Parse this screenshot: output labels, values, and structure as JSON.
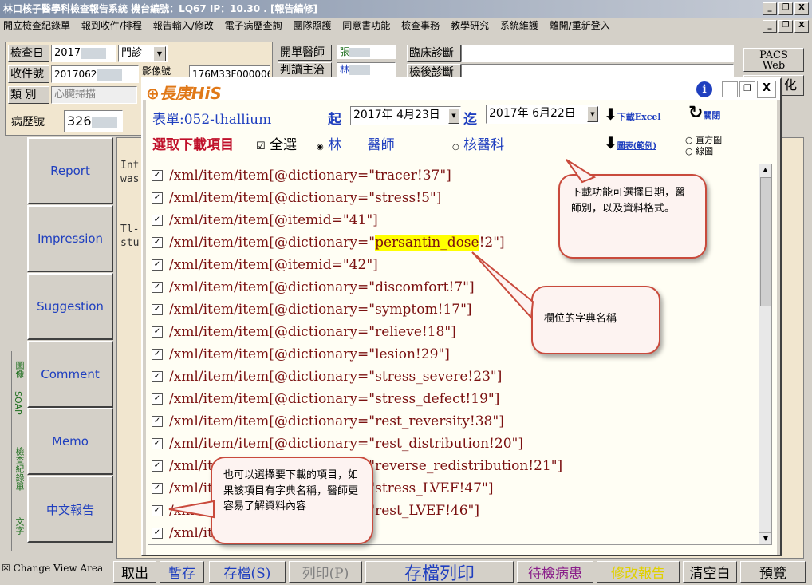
{
  "window": {
    "title": "林口核子醫學科檢查報告系統   機台編號：LQ67   IP：10.30       .     [報告編修]",
    "controls": [
      "_",
      "❐",
      "X"
    ]
  },
  "menu": [
    "開立檢查紀錄單",
    "報到收件/排程",
    "報告輸入/修改",
    "電子病歷查詢",
    "團隊照護",
    "同意書功能",
    "檢查事務",
    "教學研究",
    "系統維護",
    "離開/重新登入"
  ],
  "header": {
    "exam_date_label": "檢查日",
    "exam_date_value": "2017",
    "clinic_select": "門診",
    "receipt_label": "收件號",
    "receipt_value": "2017062",
    "image_no_label": "影像號",
    "image_no_value": "176M33F000006",
    "type_label": "類    別",
    "type_value": "心臟掃描",
    "chart_label": "病歷號",
    "chart_value": "326",
    "order_doctor_label": "開單醫師",
    "order_doctor_value": "張",
    "reading_doctor_label": "判讀主治",
    "reading_doctor_value": "林",
    "clinical_dx_label": "臨床診斷",
    "post_dx_label": "檢後診斷",
    "pacs_label": "PACS\nWeb",
    "style_button": "化"
  },
  "sidebar": {
    "buttons": [
      "Report",
      "Impression",
      "Suggestion",
      "Comment",
      "Memo",
      "中文報告"
    ],
    "vtabs": [
      "圖像",
      "SOAP",
      "檢查紀錄單",
      "文字"
    ]
  },
  "report_text": [
    "Int",
    "was",
    "Tl-",
    "stu"
  ],
  "bottom": {
    "change_view": "Change View Area",
    "buttons": [
      "取出",
      "暫存",
      "存檔(S)",
      "列印(P)",
      "存檔列印",
      "待檢病患",
      "修改報告",
      "清空白",
      "預覽"
    ]
  },
  "dialog": {
    "logo": "長庚HiS",
    "form_label": "表單:052-thallium",
    "from_label": "起",
    "from_date": "2017年  4月23日",
    "to_label": "迄",
    "to_date": "2017年  6月22日",
    "download_excel": "下載Excel",
    "close": "關閉",
    "select_label": "選取下載項目",
    "select_all": "全選",
    "doctor_option": "林      醫師",
    "dept_option": "核醫科",
    "chart_download": "圖表(範例)",
    "histogram": "直方圖",
    "linechart": "線圖",
    "items": [
      {
        "pre": "/xml/item/item[@dictionary=\"",
        "hl": "",
        "post": "tracer!37\"]"
      },
      {
        "pre": "/xml/item/item[@dictionary=\"",
        "hl": "",
        "post": "stress!5\"]"
      },
      {
        "pre": "/xml/item/item[@itemid=\"41\"]",
        "hl": "",
        "post": ""
      },
      {
        "pre": "/xml/item/item[@dictionary=\"",
        "hl": "persantin_dose",
        "post": "!2\"]"
      },
      {
        "pre": "/xml/item/item[@itemid=\"42\"]",
        "hl": "",
        "post": ""
      },
      {
        "pre": "/xml/item/item[@dictionary=\"",
        "hl": "",
        "post": "discomfort!7\"]"
      },
      {
        "pre": "/xml/item/item[@dictionary=\"",
        "hl": "",
        "post": "symptom!17\"]"
      },
      {
        "pre": "/xml/item/item[@dictionary=\"",
        "hl": "",
        "post": "relieve!18\"]"
      },
      {
        "pre": "/xml/item/item[@dictionary=\"",
        "hl": "",
        "post": "lesion!29\"]"
      },
      {
        "pre": "/xml/item/item[@dictionary=\"",
        "hl": "",
        "post": "stress_severe!23\"]"
      },
      {
        "pre": "/xml/item/item[@dictionary=\"",
        "hl": "",
        "post": "stress_defect!19\"]"
      },
      {
        "pre": "/xml/item/item[@dictionary=\"",
        "hl": "",
        "post": "rest_reversity!38\"]"
      },
      {
        "pre": "/xml/item/item[@dictionary=\"",
        "hl": "",
        "post": "rest_distribution!20\"]"
      },
      {
        "pre": "/xml/item/item[@dictionary=\"",
        "hl": "",
        "post": "reverse_redistribution!21\"]"
      },
      {
        "pre": "/xml/item/item[@dictionary=\"",
        "hl": "",
        "post": "stress_LVEF!47\"]"
      },
      {
        "pre": "/xml/item/item[@dictionary=\"",
        "hl": "",
        "post": "rest_LVEF!46\"]"
      },
      {
        "pre": "/xml/it",
        "hl": "",
        "post": "\"]"
      }
    ]
  },
  "callouts": {
    "download": "下載功能可選擇日期，醫師別，以及資料格式。",
    "dictionary": "欄位的字典名稱",
    "items": "也可以選擇要下載的項目，如果該項目有字典名稱，醫師更容易了解資料內容"
  },
  "colors": {
    "accent": "#1f3fbf",
    "item_text": "#7a1010",
    "callout_border": "#c94a3c",
    "highlight": "#ffff00"
  }
}
